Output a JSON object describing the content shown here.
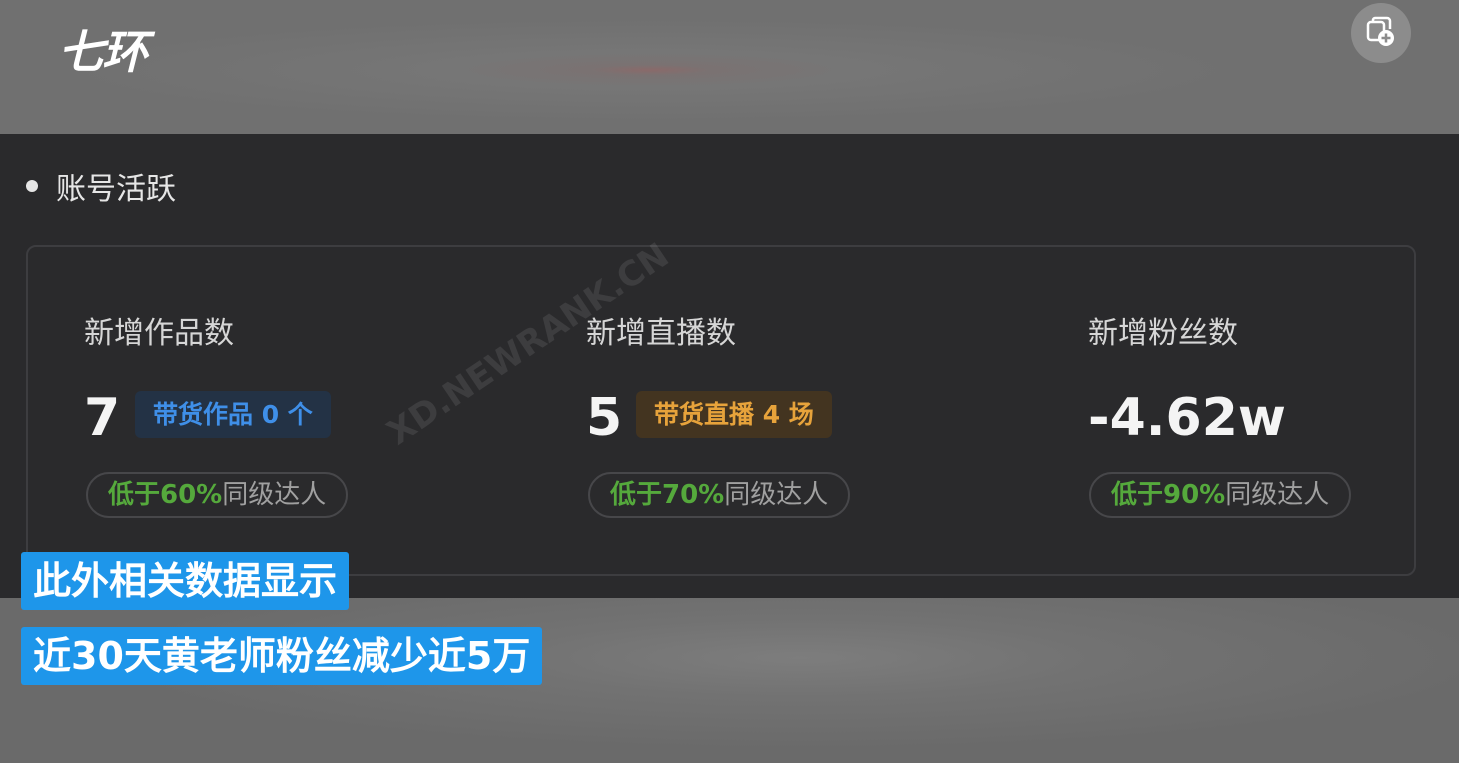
{
  "header": {
    "logo_text": "七环",
    "copy_button_icon": "copy-plus-icon"
  },
  "section": {
    "title": "账号活跃"
  },
  "stats": [
    {
      "label": "新增作品数",
      "value": "7",
      "tag": "带货作品 0 个",
      "pill_highlight": "低于60%",
      "pill_text": "同级达人"
    },
    {
      "label": "新增直播数",
      "value": "5",
      "tag": "带货直播 4 场",
      "pill_highlight": "低于70%",
      "pill_text": "同级达人"
    },
    {
      "label": "新增粉丝数",
      "value": "-4.62w",
      "pill_highlight": "低于90%",
      "pill_text": "同级达人"
    }
  ],
  "watermark": "XD.NEWRANK.CN",
  "subtitles": [
    "此外相关数据显示",
    "近30天黄老师粉丝减少近5万"
  ],
  "colors": {
    "panel_bg": "#2a2a2c",
    "tag_blue": "#3f8fe8",
    "tag_orange": "#e7a33b",
    "pill_green": "#55a93c",
    "subtitle_bg": "#1e96ea"
  }
}
